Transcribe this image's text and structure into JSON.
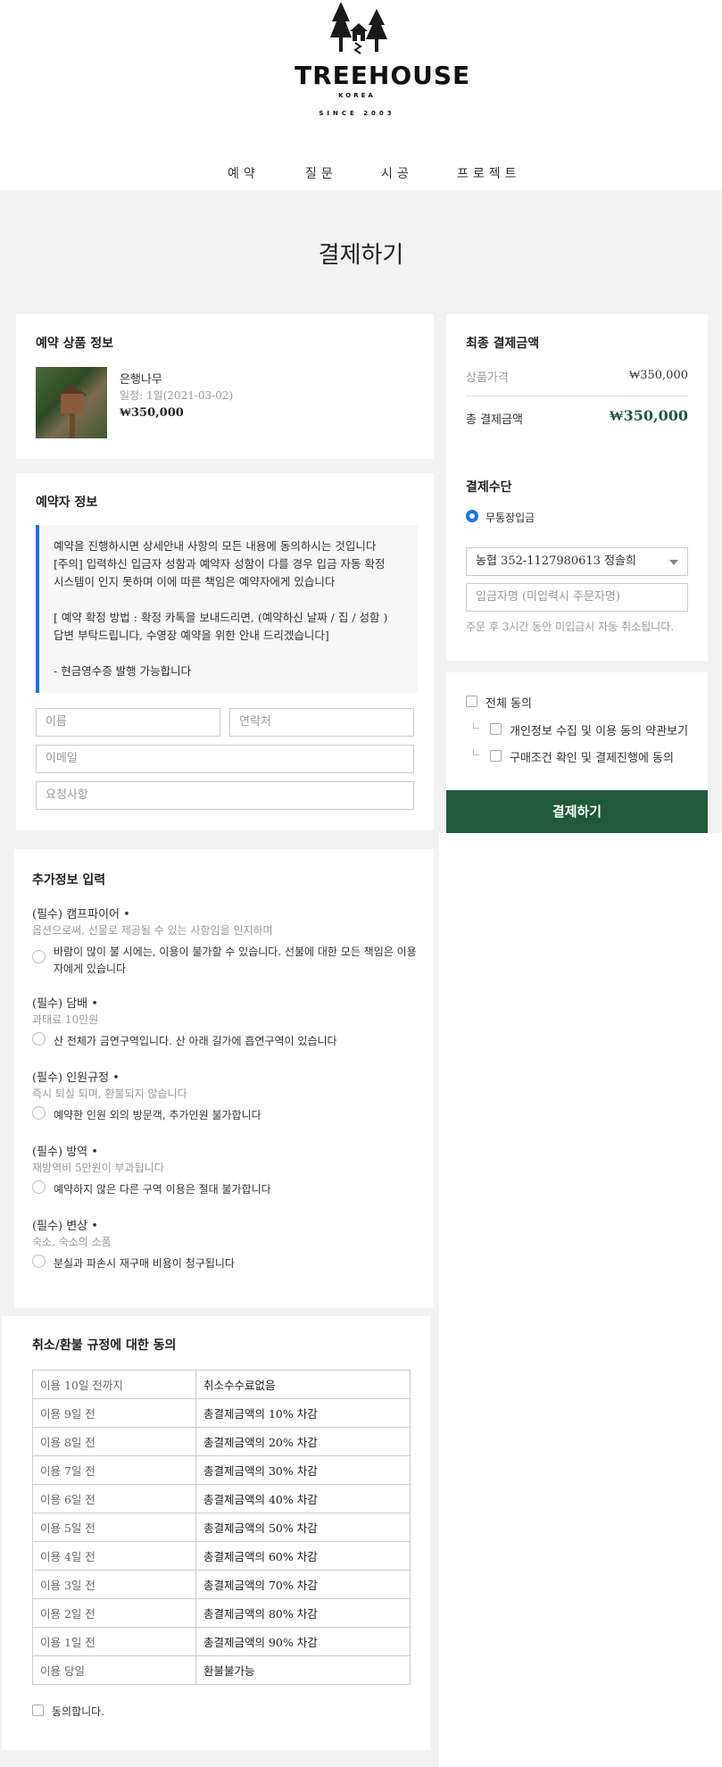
{
  "brand": {
    "name": "TREEHOUSE",
    "sub": "KOREA",
    "since": "SINCE 2003"
  },
  "nav": [
    "예약",
    "질문",
    "시공",
    "프로젝트"
  ],
  "page_title": "결제하기",
  "product": {
    "section_title": "예약 상품 정보",
    "name": "은행나무",
    "schedule": "일정: 1일(2021-03-02)",
    "price": "₩350,000"
  },
  "booker": {
    "section_title": "예약자 정보",
    "notice_lines": [
      "예약을 진행하시면 상세안내 사항의 모든 내용에 동의하시는 것입니다",
      "[주의] 입력하신 입금자 성함과 예약자 성함이 다를 경우 입금 자동 확정",
      "시스템이 인지 못하며 이에 따른 책임은 예약자에게 있습니다",
      "",
      "[ 예약 확정 방법 : 확정 카톡을 보내드리면, (예약하신 날짜 / 집 / 성함 )",
      "답변 부탁드립니다, 수영장 예약을 위한 안내 드리겠습니다]",
      "",
      "- 현금영수증 발행 가능합니다"
    ],
    "placeholders": {
      "name": "이름",
      "phone": "연락처",
      "email": "이메일",
      "request": "요청사항"
    }
  },
  "summary": {
    "section_title": "최종 결제금액",
    "item_label": "상품가격",
    "item_value": "₩350,000",
    "total_label": "총 결제금액",
    "total_value": "₩350,000"
  },
  "payment": {
    "section_title": "결제수단",
    "method": "무통장입금",
    "bank_selected": "농협 352-1127980613 정솔희",
    "depositor_placeholder": "입금자명 (미입력시 주문자명)",
    "note": "주문 후 3시간 동안 미입금시 자동 취소됩니다."
  },
  "agreement": {
    "all": "전체 동의",
    "items": [
      "개인정보 수집 및 이용 동의 약관보기",
      "구매조건 확인 및 결제진행에 동의"
    ]
  },
  "pay_button": "결제하기",
  "extra": {
    "section_title": "추가정보 입력",
    "items": [
      {
        "title": "(필수) 캠프파이어 •",
        "desc": "옵션으로써, 선물로 제공될 수 있는 사항임을 인지하며",
        "option_lines": [
          "바람이 많이 불 시에는, 이용이 불가할 수 있습니다. 선불에 대한 모든 책임은 이용",
          "자에게 있습니다"
        ]
      },
      {
        "title": "(필수) 담배 •",
        "desc": "과태료 10만원",
        "option_lines": [
          "산 전체가 금연구역입니다. 산 아래 길가에 흡연구역이 있습니다"
        ]
      },
      {
        "title": "(필수) 인원규정 •",
        "desc": "즉시 퇴실 되며, 환불되지 않습니다",
        "option_lines": [
          "예약한 인원 외의 방문객, 추가인원 불가합니다"
        ]
      },
      {
        "title": "(필수) 방역 •",
        "desc": "재방역비 5만원이 부과됩니다",
        "option_lines": [
          "예약하지 않은 다른 구역 이용은 절대 불가합니다"
        ]
      },
      {
        "title": "(필수) 변상 •",
        "desc": "숙소, 숙소의 소품",
        "option_lines": [
          "분실과 파손시 재구매 비용이 청구됩니다"
        ]
      }
    ]
  },
  "refund": {
    "section_title": "취소/환불 규정에 대한 동의",
    "rows": [
      [
        "이용 10일 전까지",
        "취소수수료없음"
      ],
      [
        "이용 9일 전",
        "총결제금액의 10% 차감"
      ],
      [
        "이용 8일 전",
        "총결제금액의 20% 차감"
      ],
      [
        "이용 7일 전",
        "총결제금액의 30% 차감"
      ],
      [
        "이용 6일 전",
        "총결제금액의 40% 차감"
      ],
      [
        "이용 5일 전",
        "총결제금액의 50% 차감"
      ],
      [
        "이용 4일 전",
        "총결제금액의 60% 차감"
      ],
      [
        "이용 3일 전",
        "총결제금액의 70% 차감"
      ],
      [
        "이용 2일 전",
        "총결제금액의 80% 차감"
      ],
      [
        "이용 1일 전",
        "총결제금액의 90% 차감"
      ],
      [
        "이용 당일",
        "환불불가능"
      ]
    ],
    "agree_label": "동의합니다."
  },
  "colors": {
    "accent_blue": "#1a73e8",
    "brand_green": "#1f5a3a",
    "background_gray": "#f2f2f2"
  }
}
